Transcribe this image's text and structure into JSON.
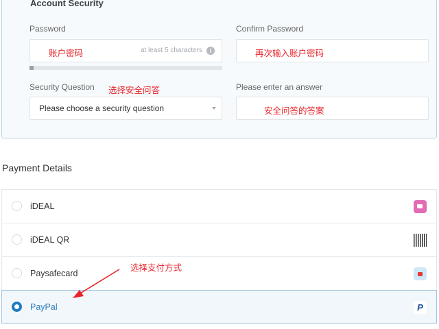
{
  "security": {
    "title": "Account Security",
    "password_label": "Password",
    "password_annotation": "账户密码",
    "password_hint": "at least 5 characters",
    "password_strength": 0.02,
    "confirm_label": "Confirm Password",
    "confirm_annotation": "再次输入账户密码",
    "question_label": "Security Question",
    "question_annotation": "选择安全问答",
    "question_selected": "Please choose a security question",
    "answer_label": "Please enter an answer",
    "answer_annotation": "安全问答的答案"
  },
  "payment": {
    "title": "Payment Details",
    "annotation": "选择支付方式",
    "methods": [
      {
        "label": "iDEAL",
        "icon": "ideal-icon",
        "selected": false
      },
      {
        "label": "iDEAL QR",
        "icon": "qr-code-icon",
        "selected": false
      },
      {
        "label": "Paysafecard",
        "icon": "paysafecard-icon",
        "selected": false
      },
      {
        "label": "PayPal",
        "icon": "paypal-icon",
        "selected": true
      }
    ]
  },
  "colors": {
    "annotation_red": "#e8232a",
    "accent_blue": "#1f7ac0",
    "panel_bg": "#f6fafc"
  }
}
